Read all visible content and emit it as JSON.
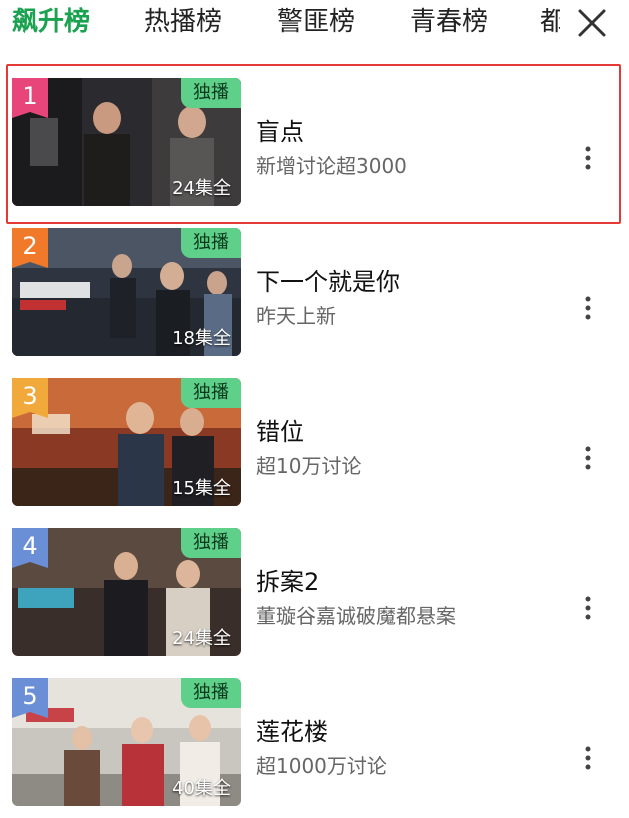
{
  "tabs": [
    {
      "label": "飙升榜",
      "active": true
    },
    {
      "label": "热播榜",
      "active": false
    },
    {
      "label": "警匪榜",
      "active": false
    },
    {
      "label": "青春榜",
      "active": false
    },
    {
      "label": "都",
      "active": false
    }
  ],
  "close_icon": "close-icon",
  "colors": {
    "active_tab": "#1aa250",
    "badge": "#5fd08a",
    "highlight_border": "#e53935",
    "rank1": "#e8457a",
    "rank2": "#f07a2a",
    "rank3": "#f2a93b",
    "rank_other": "#6b8fd6"
  },
  "items": [
    {
      "rank": "1",
      "badge": "独播",
      "episodes": "24集全",
      "title": "盲点",
      "subtitle": "新增讨论超3000",
      "highlighted": true
    },
    {
      "rank": "2",
      "badge": "独播",
      "episodes": "18集全",
      "title": "下一个就是你",
      "subtitle": "昨天上新"
    },
    {
      "rank": "3",
      "badge": "独播",
      "episodes": "15集全",
      "title": "错位",
      "subtitle": "超10万讨论"
    },
    {
      "rank": "4",
      "badge": "独播",
      "episodes": "24集全",
      "title": "拆案2",
      "subtitle": "董璇谷嘉诚破魔都悬案"
    },
    {
      "rank": "5",
      "badge": "独播",
      "episodes": "40集全",
      "title": "莲花楼",
      "subtitle": "超1000万讨论"
    }
  ]
}
